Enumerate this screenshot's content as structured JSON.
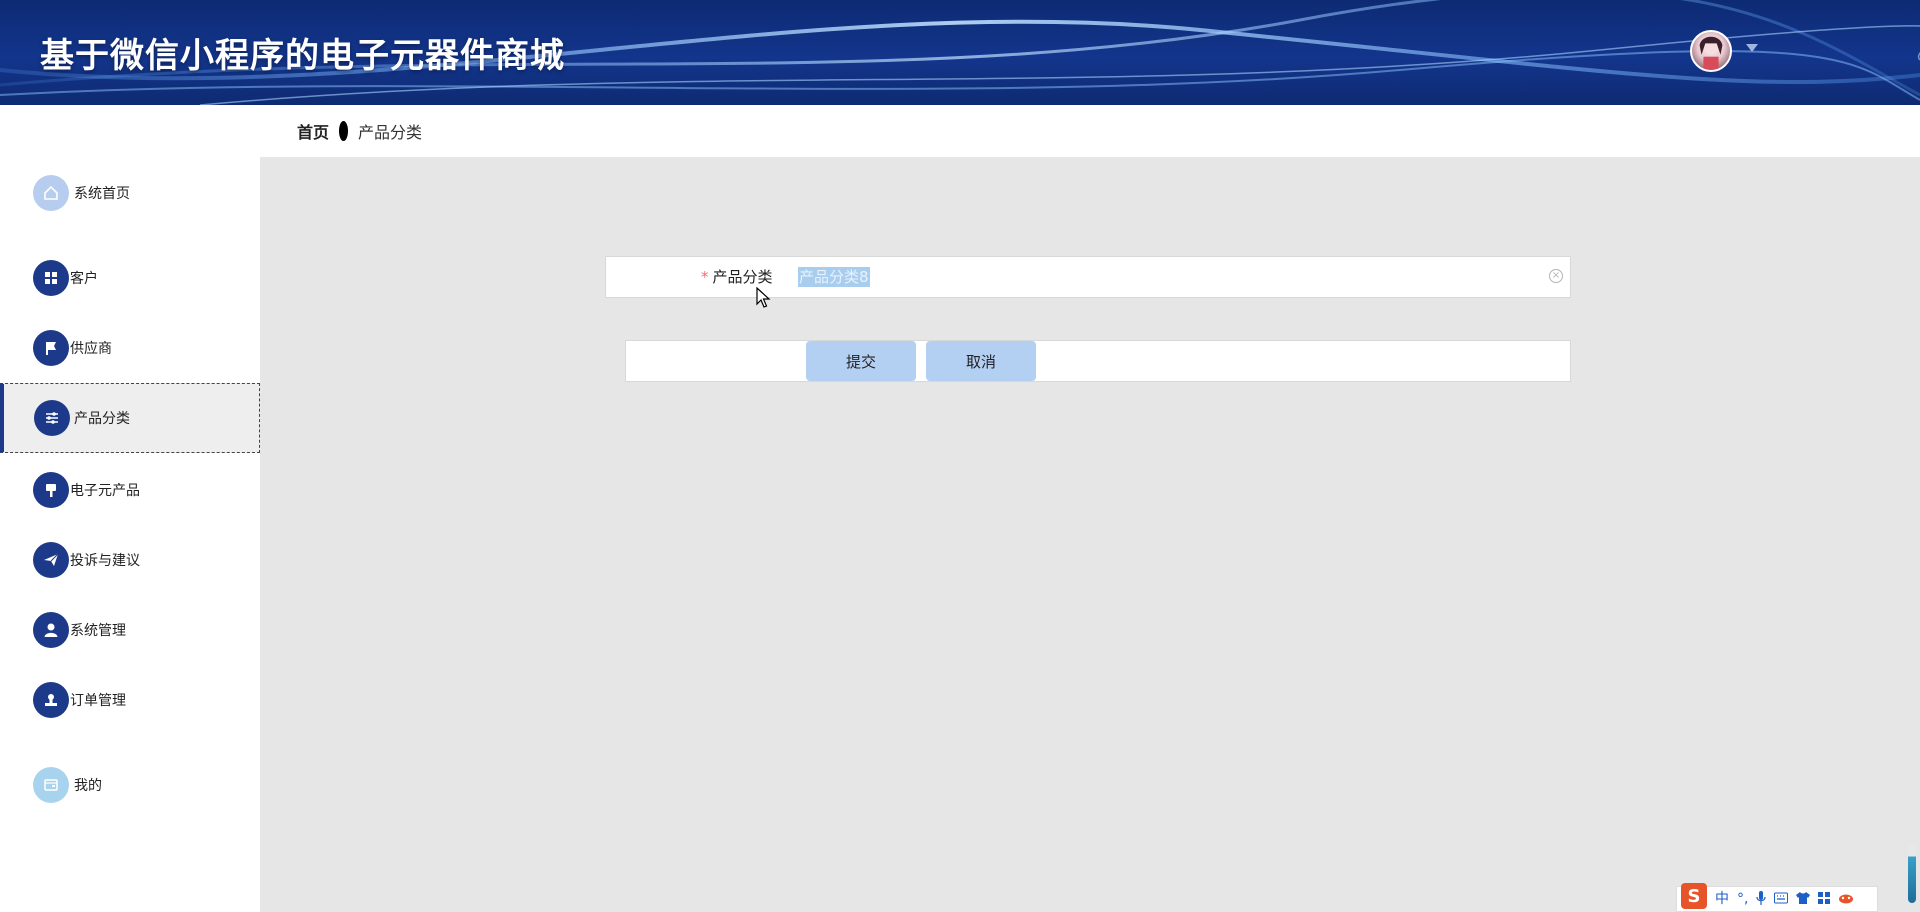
{
  "header": {
    "title": "基于微信小程序的电子元器件商城",
    "avatar_icon": "user-avatar",
    "caret_icon": "caret-down-icon"
  },
  "breadcrumb": {
    "home": "首页",
    "current": "产品分类"
  },
  "sidebar": {
    "items": [
      {
        "label": "系统首页",
        "icon": "home-icon"
      },
      {
        "label": "客户",
        "icon": "grid-icon"
      },
      {
        "label": "供应商",
        "icon": "flag-icon"
      },
      {
        "label": "产品分类",
        "icon": "sliders-icon"
      },
      {
        "label": "电子元产品",
        "icon": "brush-icon"
      },
      {
        "label": "投诉与建议",
        "icon": "paper-plane-icon"
      },
      {
        "label": "系统管理",
        "icon": "user-icon"
      },
      {
        "label": "订单管理",
        "icon": "stamp-icon"
      },
      {
        "label": "我的",
        "icon": "wallet-icon"
      }
    ],
    "active_index": 3
  },
  "form": {
    "field_label": "产品分类",
    "required_mark": "*",
    "field_value": "产品分类8",
    "clear_icon": "circle-close-icon"
  },
  "buttons": {
    "submit": "提交",
    "cancel": "取消"
  },
  "ime": {
    "logo": "S",
    "mode": "中",
    "punct": "°,"
  },
  "colors": {
    "header": "#13358c",
    "accent": "#1d3a8a",
    "button": "#b3cff2",
    "required": "#f56c6c"
  }
}
